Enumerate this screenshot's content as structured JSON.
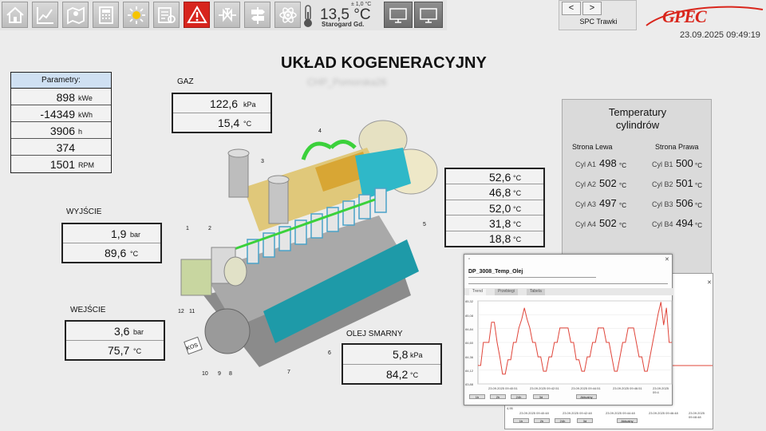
{
  "toolbar": {
    "buttons": [
      "home-icon",
      "chart-icon",
      "map-icon",
      "calculator-icon",
      "sun-icon",
      "report-icon",
      "alarm-icon",
      "valve-icon",
      "signpost-icon",
      "atom-icon",
      "thermometer-icon"
    ],
    "weather": {
      "temp_value": "13,5",
      "temp_unit": "°C",
      "temp_delta": "± 1,0 °C",
      "city": "Starogard Gd."
    },
    "monitors": [
      "monitor-1-icon",
      "monitor-2-icon"
    ]
  },
  "nav": {
    "prev_label": "<",
    "next_label": ">",
    "station": "SPC Trawki"
  },
  "logo": {
    "text": "GPEC"
  },
  "datetime": "23.09.2025 09:49:19",
  "page": {
    "title": "UKŁAD KOGENERACYJNY",
    "subtitle": "CHP_Pomorska26"
  },
  "parameters": {
    "header": "Parametry:",
    "rows": [
      {
        "value": "898",
        "unit": "kWe"
      },
      {
        "value": "-14349",
        "unit": "kWh"
      },
      {
        "value": "3906",
        "unit": "h"
      },
      {
        "value": "374",
        "unit": ""
      },
      {
        "value": "1501",
        "unit": "RPM"
      }
    ]
  },
  "gas": {
    "label": "GAZ",
    "rows": [
      {
        "value": "122,6",
        "unit": "kPa"
      },
      {
        "value": "15,4",
        "unit": "°C"
      }
    ]
  },
  "output": {
    "label": "WYJŚCIE",
    "rows": [
      {
        "value": "1,9",
        "unit": "bar"
      },
      {
        "value": "89,6",
        "unit": "°C"
      }
    ]
  },
  "input": {
    "label": "WEJŚCIE",
    "rows": [
      {
        "value": "3,6",
        "unit": "bar"
      },
      {
        "value": "75,7",
        "unit": "°C"
      }
    ]
  },
  "oil": {
    "label": "OLEJ SMARNY",
    "rows": [
      {
        "value": "5,8",
        "unit": "kPa"
      },
      {
        "value": "84,2",
        "unit": "°C"
      }
    ]
  },
  "right_temps": {
    "rows": [
      {
        "value": "52,6",
        "unit": "°C"
      },
      {
        "value": "46,8",
        "unit": "°C"
      },
      {
        "value": "52,0",
        "unit": "°C"
      },
      {
        "value": "31,8",
        "unit": "°C"
      },
      {
        "value": "18,8",
        "unit": "°C"
      }
    ]
  },
  "engine_callouts": [
    "1",
    "2",
    "3",
    "4",
    "5",
    "6",
    "7",
    "8",
    "9",
    "10",
    "11",
    "12"
  ],
  "engine_plate": "KOS",
  "cylinders": {
    "title_line1": "Temperatury",
    "title_line2": "cylindrów",
    "left_header": "Strona Lewa",
    "right_header": "Strona Prawa",
    "left": [
      {
        "name": "Cyl A1",
        "value": "498",
        "unit": "°C"
      },
      {
        "name": "Cyl A2",
        "value": "502",
        "unit": "°C"
      },
      {
        "name": "Cyl A3",
        "value": "497",
        "unit": "°C"
      },
      {
        "name": "Cyl A4",
        "value": "502",
        "unit": "°C"
      }
    ],
    "right": [
      {
        "name": "Cyl B1",
        "value": "500",
        "unit": "°C"
      },
      {
        "name": "Cyl B2",
        "value": "501",
        "unit": "°C"
      },
      {
        "name": "Cyl B3",
        "value": "506",
        "unit": "°C"
      },
      {
        "name": "Cyl B4",
        "value": "494",
        "unit": "°C"
      }
    ]
  },
  "trend": {
    "close_label": "✕",
    "tag": "DP_3008_Temp_Olej",
    "tabs": [
      "Trend",
      "Przebiegi",
      "Tabela"
    ],
    "y_ticks": [
      "85,32",
      "85,08",
      "84,84",
      "84,60",
      "84,36",
      "84,12",
      "83,88"
    ],
    "x_ticks": [
      "23.09.2025 09:40:51",
      "23.09.2025 09:42:51",
      "23.09.2025 09:44:51",
      "23.09.2025 09:46:51",
      "23.09.2025 09:4"
    ],
    "buttons": [
      "1h",
      "2h",
      "24h",
      "3d",
      "Aktualny"
    ],
    "back_x_ticks": [
      "23.09.2025 09:40:48",
      "23.09.2025 09:42:48",
      "23.09.2025 09:44:48",
      "23.09.2025 09:46:48",
      "23.09.2025 09:48:48"
    ],
    "back_y_tick": "4,95",
    "series_color": "#e0453a",
    "series": [
      84.2,
      84.2,
      84.6,
      84.6,
      84.6,
      84.95,
      84.95,
      84.6,
      84.35,
      84.05,
      84.05,
      84.3,
      84.3,
      84.6,
      84.6,
      84.85,
      85.0,
      85.2,
      85.0,
      84.85,
      84.6,
      84.6,
      84.35,
      84.35,
      84.1,
      84.1,
      84.35,
      84.35,
      84.6,
      84.6,
      84.85,
      84.85,
      84.85,
      84.85,
      84.6,
      84.6,
      84.3,
      84.3,
      84.1,
      84.1,
      84.35,
      84.35,
      84.6,
      84.6,
      84.85,
      84.85,
      84.85,
      84.6,
      84.6,
      84.35,
      84.1,
      84.1,
      84.35,
      84.6,
      84.6,
      84.85,
      84.85,
      84.85,
      84.6,
      84.35,
      84.35,
      84.1,
      84.1,
      84.35,
      84.6,
      84.85,
      85.1,
      85.3,
      84.9,
      85.2,
      84.6,
      84.6
    ]
  }
}
